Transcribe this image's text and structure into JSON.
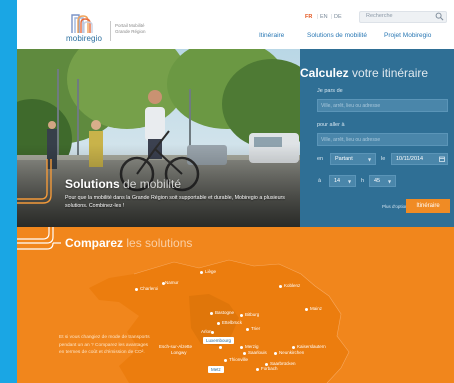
{
  "brand": {
    "name": "mobiregio",
    "tagline_line1": "Portail Mobilité",
    "tagline_line2": "Grande Région"
  },
  "languages": [
    "FR",
    "EN",
    "DE"
  ],
  "search": {
    "placeholder": "Recherche"
  },
  "nav": [
    "Itinéraire",
    "Solutions de mobilité",
    "Projet Mobiregio"
  ],
  "hero": {
    "title_bold": "Solutions",
    "title_light": "de mobilité",
    "description": "Pour que la mobilité dans la Grande Région soit supportable et durable, Mobiregio a plusieurs solutions. Combinez-les !"
  },
  "calculator": {
    "title_bold": "Calculez",
    "title_light": "votre itinéraire",
    "from_label": "Je pars de",
    "from_placeholder": "Ville, arrêt, lieu ou adresse",
    "to_label": "pour aller à",
    "to_placeholder": "Ville, arrêt, lieu ou adresse",
    "en_label": "en",
    "mode": "Partant",
    "date_label": "le",
    "date": "10/11/2014",
    "at_label": "à",
    "hour": "14",
    "h_label": "h",
    "minute": "45",
    "options_link": "Plus d'options",
    "submit": "Itinéraire"
  },
  "compare": {
    "title_bold": "Comparez",
    "title_light": "les solutions",
    "description": "Et si vous changiez de mode de transports pendant un an ? Comparez les avantages en termes de coût et d'émission de CO²."
  },
  "map": {
    "cities": [
      "Liège",
      "Namur",
      "Charleroi",
      "Koblenz",
      "Mainz",
      "Bastogne",
      "Bitburg",
      "Ettelbrück",
      "Trier",
      "Arlon",
      "Esch-sur-Alzette",
      "Longwy",
      "Merzig",
      "Saarlouis",
      "Neunkirchen",
      "Kaiserslautern",
      "Thionville",
      "Saarbrücken",
      "Forbach"
    ],
    "highlighted": [
      "Luxembourg",
      "Metz"
    ]
  },
  "colors": {
    "accent_blue": "#1aa6e4",
    "calc_panel": "#2f6f95",
    "orange": "#f1861c",
    "button": "#f08b24"
  }
}
